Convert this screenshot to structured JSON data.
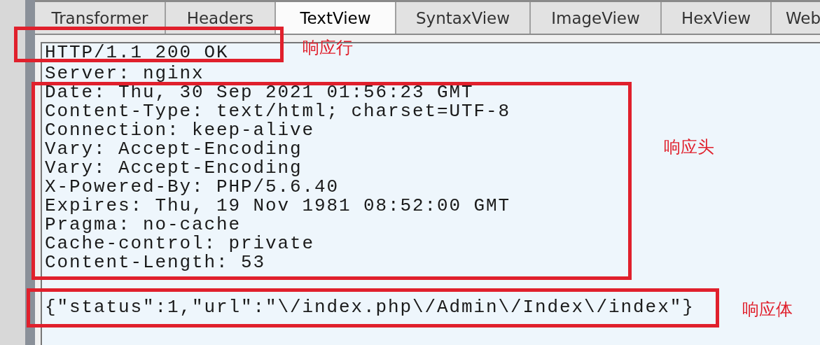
{
  "tabs": [
    {
      "label": "Transformer",
      "selected": false
    },
    {
      "label": "Headers",
      "selected": false
    },
    {
      "label": "TextView",
      "selected": true
    },
    {
      "label": "SyntaxView",
      "selected": false
    },
    {
      "label": "ImageView",
      "selected": false
    },
    {
      "label": "HexView",
      "selected": false
    },
    {
      "label": "Web",
      "selected": false
    }
  ],
  "response": {
    "status_line": "HTTP/1.1 200 OK",
    "headers": [
      "Server: nginx",
      "Date: Thu, 30 Sep 2021 01:56:23 GMT",
      "Content-Type: text/html; charset=UTF-8",
      "Connection: keep-alive",
      "Vary: Accept-Encoding",
      "Vary: Accept-Encoding",
      "X-Powered-By: PHP/5.6.40",
      "Expires: Thu, 19 Nov 1981 08:52:00 GMT",
      "Pragma: no-cache",
      "Cache-control: private",
      "Content-Length: 53"
    ],
    "body": "{\"status\":1,\"url\":\"\\/index.php\\/Admin\\/Index\\/index\"}"
  },
  "annotations": [
    {
      "label": "响应行"
    },
    {
      "label": "响应头"
    },
    {
      "label": "响应体"
    }
  ]
}
